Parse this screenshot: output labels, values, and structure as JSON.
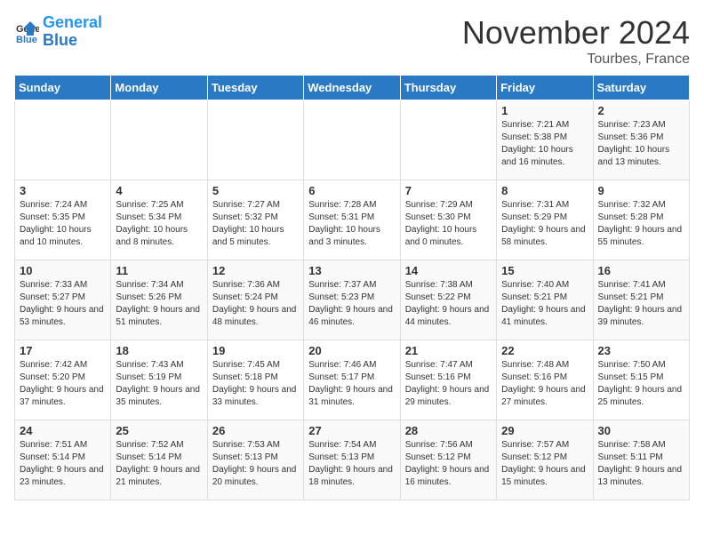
{
  "header": {
    "logo_line1": "General",
    "logo_line2": "Blue",
    "month": "November 2024",
    "location": "Tourbes, France"
  },
  "weekdays": [
    "Sunday",
    "Monday",
    "Tuesday",
    "Wednesday",
    "Thursday",
    "Friday",
    "Saturday"
  ],
  "weeks": [
    [
      {
        "day": "",
        "info": ""
      },
      {
        "day": "",
        "info": ""
      },
      {
        "day": "",
        "info": ""
      },
      {
        "day": "",
        "info": ""
      },
      {
        "day": "",
        "info": ""
      },
      {
        "day": "1",
        "info": "Sunrise: 7:21 AM\nSunset: 5:38 PM\nDaylight: 10 hours and 16 minutes."
      },
      {
        "day": "2",
        "info": "Sunrise: 7:23 AM\nSunset: 5:36 PM\nDaylight: 10 hours and 13 minutes."
      }
    ],
    [
      {
        "day": "3",
        "info": "Sunrise: 7:24 AM\nSunset: 5:35 PM\nDaylight: 10 hours and 10 minutes."
      },
      {
        "day": "4",
        "info": "Sunrise: 7:25 AM\nSunset: 5:34 PM\nDaylight: 10 hours and 8 minutes."
      },
      {
        "day": "5",
        "info": "Sunrise: 7:27 AM\nSunset: 5:32 PM\nDaylight: 10 hours and 5 minutes."
      },
      {
        "day": "6",
        "info": "Sunrise: 7:28 AM\nSunset: 5:31 PM\nDaylight: 10 hours and 3 minutes."
      },
      {
        "day": "7",
        "info": "Sunrise: 7:29 AM\nSunset: 5:30 PM\nDaylight: 10 hours and 0 minutes."
      },
      {
        "day": "8",
        "info": "Sunrise: 7:31 AM\nSunset: 5:29 PM\nDaylight: 9 hours and 58 minutes."
      },
      {
        "day": "9",
        "info": "Sunrise: 7:32 AM\nSunset: 5:28 PM\nDaylight: 9 hours and 55 minutes."
      }
    ],
    [
      {
        "day": "10",
        "info": "Sunrise: 7:33 AM\nSunset: 5:27 PM\nDaylight: 9 hours and 53 minutes."
      },
      {
        "day": "11",
        "info": "Sunrise: 7:34 AM\nSunset: 5:26 PM\nDaylight: 9 hours and 51 minutes."
      },
      {
        "day": "12",
        "info": "Sunrise: 7:36 AM\nSunset: 5:24 PM\nDaylight: 9 hours and 48 minutes."
      },
      {
        "day": "13",
        "info": "Sunrise: 7:37 AM\nSunset: 5:23 PM\nDaylight: 9 hours and 46 minutes."
      },
      {
        "day": "14",
        "info": "Sunrise: 7:38 AM\nSunset: 5:22 PM\nDaylight: 9 hours and 44 minutes."
      },
      {
        "day": "15",
        "info": "Sunrise: 7:40 AM\nSunset: 5:21 PM\nDaylight: 9 hours and 41 minutes."
      },
      {
        "day": "16",
        "info": "Sunrise: 7:41 AM\nSunset: 5:21 PM\nDaylight: 9 hours and 39 minutes."
      }
    ],
    [
      {
        "day": "17",
        "info": "Sunrise: 7:42 AM\nSunset: 5:20 PM\nDaylight: 9 hours and 37 minutes."
      },
      {
        "day": "18",
        "info": "Sunrise: 7:43 AM\nSunset: 5:19 PM\nDaylight: 9 hours and 35 minutes."
      },
      {
        "day": "19",
        "info": "Sunrise: 7:45 AM\nSunset: 5:18 PM\nDaylight: 9 hours and 33 minutes."
      },
      {
        "day": "20",
        "info": "Sunrise: 7:46 AM\nSunset: 5:17 PM\nDaylight: 9 hours and 31 minutes."
      },
      {
        "day": "21",
        "info": "Sunrise: 7:47 AM\nSunset: 5:16 PM\nDaylight: 9 hours and 29 minutes."
      },
      {
        "day": "22",
        "info": "Sunrise: 7:48 AM\nSunset: 5:16 PM\nDaylight: 9 hours and 27 minutes."
      },
      {
        "day": "23",
        "info": "Sunrise: 7:50 AM\nSunset: 5:15 PM\nDaylight: 9 hours and 25 minutes."
      }
    ],
    [
      {
        "day": "24",
        "info": "Sunrise: 7:51 AM\nSunset: 5:14 PM\nDaylight: 9 hours and 23 minutes."
      },
      {
        "day": "25",
        "info": "Sunrise: 7:52 AM\nSunset: 5:14 PM\nDaylight: 9 hours and 21 minutes."
      },
      {
        "day": "26",
        "info": "Sunrise: 7:53 AM\nSunset: 5:13 PM\nDaylight: 9 hours and 20 minutes."
      },
      {
        "day": "27",
        "info": "Sunrise: 7:54 AM\nSunset: 5:13 PM\nDaylight: 9 hours and 18 minutes."
      },
      {
        "day": "28",
        "info": "Sunrise: 7:56 AM\nSunset: 5:12 PM\nDaylight: 9 hours and 16 minutes."
      },
      {
        "day": "29",
        "info": "Sunrise: 7:57 AM\nSunset: 5:12 PM\nDaylight: 9 hours and 15 minutes."
      },
      {
        "day": "30",
        "info": "Sunrise: 7:58 AM\nSunset: 5:11 PM\nDaylight: 9 hours and 13 minutes."
      }
    ]
  ]
}
